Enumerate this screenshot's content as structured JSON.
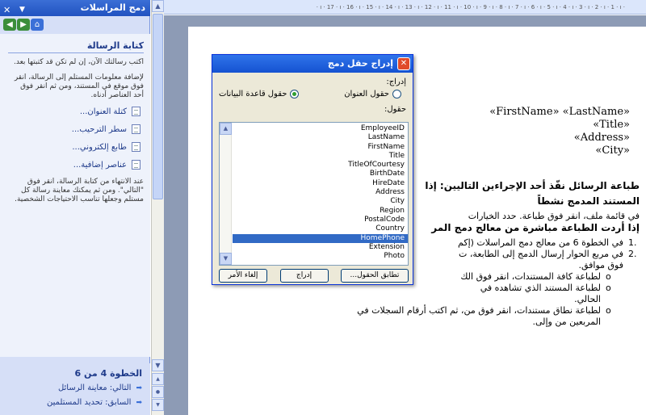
{
  "taskpane": {
    "title": "دمج المراسلات",
    "heading": "كتابة الرسالة",
    "para1": "اكتب رسالتك الآن، إن لم تكن قد كتبتها بعد.",
    "para2": "لإضافة معلومات المستلم إلى الرسالة، انقر فوق موقع في المستند، ومن ثم انقر فوق أحد العناصر أدناه.",
    "links": [
      "كتلة العنوان...",
      "سطر الترحيب...",
      "طابع إلكتروني...",
      "عناصر إضافية..."
    ],
    "para3": "عند الانتهاء من كتابة الرسالة، انقر فوق \"التالي\". ومن ثم يمكنك معاينة رسالة كل مستلم وجعلها تناسب الاحتياجات الشخصية.",
    "step": "الخطوة 4 من 6",
    "next": "التالي: معاينة الرسائل",
    "prev": "السابق: تحديد المستلمين"
  },
  "ruler": "· ı · 17 · ı · 16 · ı · 15 · ı · 14 · ı · 13 · ı · 12 · ı · 11 · ı · 10 · ı · 9 · ı · 8 · ı · 7 · ı · 6 · ı · 5 · ı · 4 · ı · 3 · ı · 2 · ı · 1 · ı ·",
  "document": {
    "merge_fields": [
      "«FirstName» «LastName»",
      "«Title»",
      "«Address»",
      "«City»"
    ],
    "heading1": "طباعة الرسائل نفّذ أحد الإجراءين التاليين: إذا",
    "heading1b": "المستند المدمج نشطاً",
    "line1": "في قائمة ملف، انقر فوق طباعة. حدد الخيارات",
    "heading2": "إذا أردت الطباعة مباشرة من معالج دمج المر",
    "list1": [
      "في الخطوة 6 من معالج دمج المراسلات (إكم",
      "في مربع الحوار إرسال الدمج إلى الطابعة، ت",
      "فوق موافق."
    ],
    "sublist": [
      "لطباعة كافة المستندات، انقر فوق الك",
      "لطباعة المستند الذي تشاهده في",
      "الحالي.",
      "لطباعة نطاق مستندات، انقر فوق من، ثم اكتب أرقام السجلات في",
      "المربعين من وإلى."
    ]
  },
  "dialog": {
    "title": "إدراج حقل دمج",
    "insert_label": "إدراج:",
    "radio_address": "حقول العنوان",
    "radio_db": "حقول قاعدة البيانات",
    "fields_label": "حقول:",
    "fields": [
      "EmployeeID",
      "LastName",
      "FirstName",
      "Title",
      "TitleOfCourtesy",
      "BirthDate",
      "HireDate",
      "Address",
      "City",
      "Region",
      "PostalCode",
      "Country",
      "HomePhone",
      "Extension",
      "Photo"
    ],
    "selected": "HomePhone",
    "btn_match": "تطابق الحقول...",
    "btn_insert": "إدراج",
    "btn_cancel": "إلغاء الأمر"
  }
}
